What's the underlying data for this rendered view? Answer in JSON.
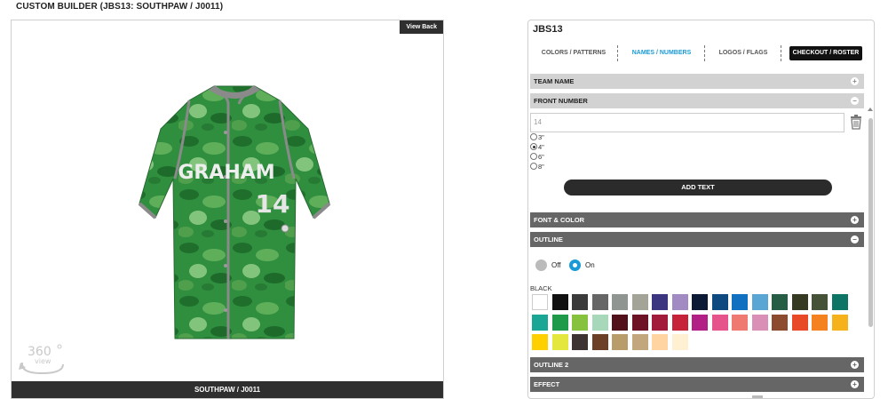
{
  "page": {
    "title": "CUSTOM BUILDER (JBS13: SOUTHPAW / J0011)"
  },
  "viewer": {
    "view_back": "View Back",
    "footer": "SOUTHPAW / J0011",
    "jersey_name": "GRAHAM",
    "jersey_number": "14",
    "badge_number": "360",
    "badge_word": "view",
    "icons": {
      "badge": "360-view-icon"
    }
  },
  "panel": {
    "title": "JBS13",
    "tabs": [
      {
        "label": "COLORS / PATTERNS"
      },
      {
        "label": "NAMES / NUMBERS"
      },
      {
        "label": "LOGOS / FLAGS"
      },
      {
        "label": "CHECKOUT / ROSTER"
      }
    ],
    "active_tab": "NAMES / NUMBERS",
    "sections": {
      "team_name": "TEAM NAME",
      "front_number": "FRONT NUMBER",
      "font_color": "FONT & COLOR",
      "outline": "OUTLINE",
      "outline2": "OUTLINE 2",
      "effect": "EFFECT"
    },
    "front_number": {
      "value": "14",
      "sizes": [
        "3\"",
        "4\"",
        "6\"",
        "8\""
      ],
      "selected_size": "4\"",
      "add_text": "ADD TEXT"
    },
    "outline": {
      "off_label": "Off",
      "on_label": "On",
      "selected_color_name": "BLACK",
      "swatches": [
        "#ffffff",
        "#111111",
        "#3b3b3b",
        "#666666",
        "#8f9692",
        "#a3a397",
        "#3c3580",
        "#a28bc2",
        "#0c1a36",
        "#0e4a80",
        "#1170c0",
        "#59a6d4",
        "#255e44",
        "#363a22",
        "#465238",
        "#0d7566",
        "#1aa695",
        "#1f9a4b",
        "#86c23e",
        "#a6d8b9",
        "#52101a",
        "#6e1225",
        "#a31b3a",
        "#c6233b",
        "#b22086",
        "#e6548c",
        "#ef7a72",
        "#d98fb6",
        "#8c4a2e",
        "#e84a27",
        "#f58220",
        "#f5b21a",
        "#ffd000",
        "#e4e73e",
        "#3d3333",
        "#6b4026",
        "#b89c6a",
        "#c2a67d",
        "#ffd4a0",
        "#fff0d2"
      ]
    }
  },
  "colors": {
    "accent": "#1a9ad6",
    "dark": "#2f2f2f",
    "jersey_green": "#2b8a3e"
  }
}
